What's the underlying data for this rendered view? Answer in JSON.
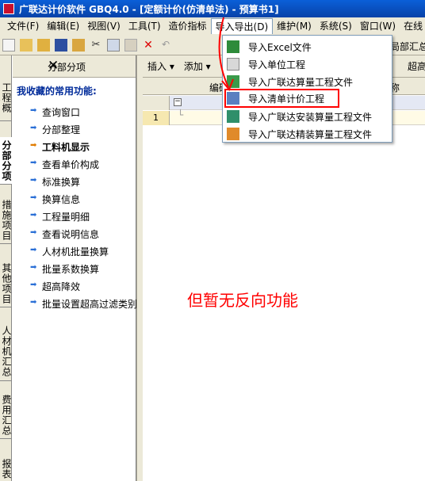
{
  "window": {
    "title": "广联达计价软件 GBQ4.0 - [定额计价(仿清单法) - 预算书1]"
  },
  "menubar": {
    "items": [
      {
        "label": "文件(F)"
      },
      {
        "label": "编辑(E)"
      },
      {
        "label": "视图(V)"
      },
      {
        "label": "工具(T)"
      },
      {
        "label": "造价指标"
      },
      {
        "label": "导入导出(D)"
      },
      {
        "label": "维护(M)"
      },
      {
        "label": "系统(S)"
      },
      {
        "label": "窗口(W)"
      },
      {
        "label": "在线"
      }
    ]
  },
  "toolbar": {
    "partial_right_text": "局部汇总"
  },
  "content_toolbar": {
    "insert": "插入 ▾",
    "add": "添加 ▾",
    "super": "超高"
  },
  "grid": {
    "col_code": "编码",
    "col_name": "名称",
    "row_number": "1",
    "collapse": "−"
  },
  "vtabs": [
    {
      "label": "工程概况"
    },
    {
      "label": "分部分项"
    },
    {
      "label": "措施项目"
    },
    {
      "label": "其他项目"
    },
    {
      "label": "人材机汇总"
    },
    {
      "label": "费用汇总"
    },
    {
      "label": "报表"
    }
  ],
  "panel": {
    "header": "分部分项",
    "close": "✕",
    "fav_title": "我收藏的常用功能:",
    "items": [
      {
        "label": "查询窗口"
      },
      {
        "label": "分部整理"
      },
      {
        "label": "工料机显示"
      },
      {
        "label": "查看单价构成"
      },
      {
        "label": "标准换算"
      },
      {
        "label": "换算信息"
      },
      {
        "label": "工程量明细"
      },
      {
        "label": "查看说明信息"
      },
      {
        "label": "人材机批量换算"
      },
      {
        "label": "批量系数换算"
      },
      {
        "label": "超高降效"
      },
      {
        "label": "批量设置超高过滤类别"
      }
    ]
  },
  "dropdown": {
    "items": [
      {
        "label": "导入Excel文件",
        "icon": "excel-icon"
      },
      {
        "label": "导入单位工程",
        "icon": "unit-project-icon"
      },
      {
        "label": "导入广联达算量工程文件",
        "icon": "gld-quantity-icon"
      },
      {
        "label": "导入清单计价工程",
        "icon": "bill-pricing-icon"
      },
      {
        "label": "导入广联达安装算量工程文件",
        "icon": "gld-install-icon"
      },
      {
        "label": "导入广联达精装算量工程文件",
        "icon": "gld-decor-icon"
      }
    ]
  },
  "annotation": "但暂无反向功能",
  "colors": {
    "titlebar": "#0842a8",
    "highlight": "#ff0000",
    "fav_title": "#002b9a"
  }
}
